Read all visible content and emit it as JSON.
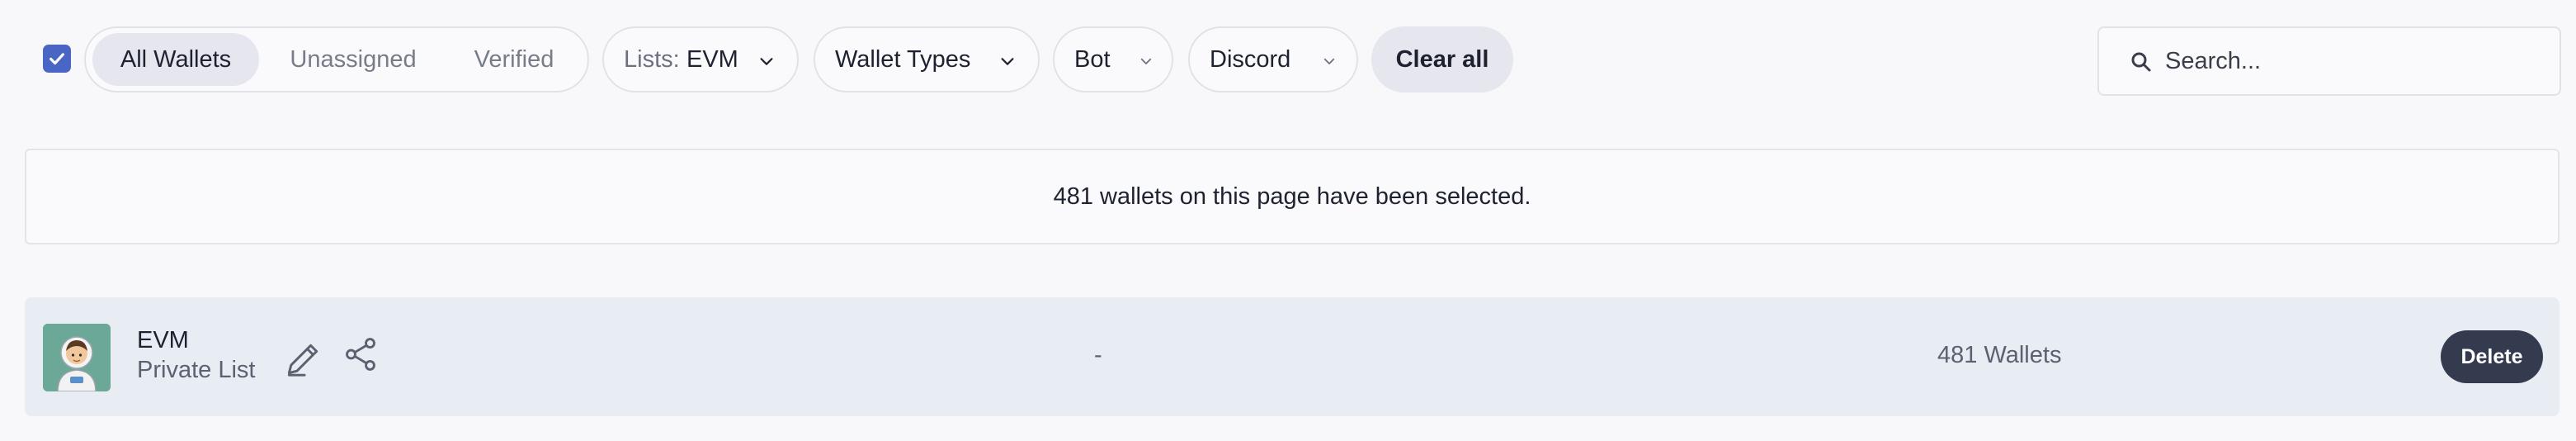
{
  "toolbar": {
    "select_all_checked": true,
    "tabs": [
      {
        "label": "All Wallets",
        "active": true
      },
      {
        "label": "Unassigned",
        "active": false
      },
      {
        "label": "Verified",
        "active": false
      }
    ],
    "lists_filter": {
      "prefix": "Lists:",
      "value": "EVM"
    },
    "wallet_types_label": "Wallet Types",
    "bot_label": "Bot",
    "discord_label": "Discord",
    "clear_all_label": "Clear all",
    "search": {
      "placeholder": "Search...",
      "value": ""
    }
  },
  "banner": {
    "text": "481 wallets on this page have been selected."
  },
  "list_row": {
    "avatar_icon": "astronaut-icon",
    "name": "EVM",
    "visibility": "Private List",
    "middle_value": "-",
    "wallet_count": "481 Wallets",
    "delete_label": "Delete"
  },
  "colors": {
    "accent": "#4a66c4",
    "delete_bg": "#353b4f",
    "row_bg": "#e8ecf3",
    "avatar_bg": "#6ca897",
    "page_bg": "#f8f8fa"
  }
}
